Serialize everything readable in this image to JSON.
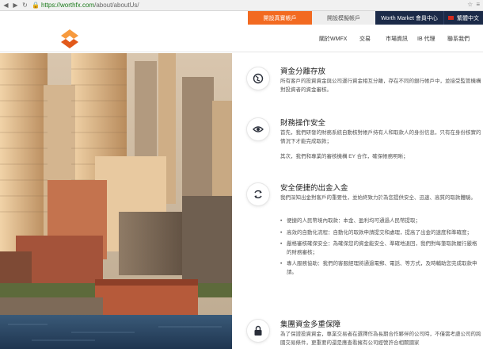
{
  "browser": {
    "url_host": "https://worthfx.com",
    "url_path": "/about/aboutUs/"
  },
  "topbar": {
    "open_account": "開設真實帳戶",
    "demo_account": "開設模擬帳戶",
    "member_center": "Worth Market 會員中心",
    "language": "繁體中文"
  },
  "nav": {
    "items": [
      "關於WMFX",
      "交易",
      "市場資訊",
      "IB 代理",
      "聯系我們"
    ]
  },
  "features": [
    {
      "icon": "globe-icon",
      "title": "資金分離存放",
      "text": "所有客戶的投資資金與公司運行資金相互分離，存在不同的銀行帳戶中，並接受監管機構對投資者的資金審核。"
    },
    {
      "icon": "eye-icon",
      "title": "財務操作安全",
      "text1": "首先，我們研發的財務系統自動核對帳戶持有人和取款人的身份信息，只有在身份核實的情況下才能完成取款；",
      "text2": "其次，我們和專業的審核機構 EY 合作，確保帳務明晰；"
    },
    {
      "icon": "refresh-icon",
      "title": "安全便捷的出金入金",
      "text": "我們深知出金對客戶的重要性，並始終致力於為您提供安全、迅速、高質的取款體驗。",
      "bullets": [
        "便捷的人民幣境內取款：本金、盈利均可通過人民幣提取；",
        "高效的自動化流程：自動化的取款申請提交和處理，提高了出金的速度和準確度；",
        "嚴格審核確保安全：為確保您的資金能安全、準確地退回，我們對每筆取款履行嚴格的財務審核；",
        "專人服務協助：我們的客服經理將通過電郵、電話、等方式，及時輔助您完成取款申請。"
      ]
    },
    {
      "icon": "lock-icon",
      "title": "集團資金多重保障",
      "text": "為了保證投資資金，專業交易者在選擇作為長期合作夥伴的公司時，不僅需考慮公司的跨國交易條件，更重要的還是應查看擁有公司經營許合相關國家"
    }
  ],
  "colors": {
    "accent": "#f26a21",
    "navy": "#1b2a48"
  }
}
